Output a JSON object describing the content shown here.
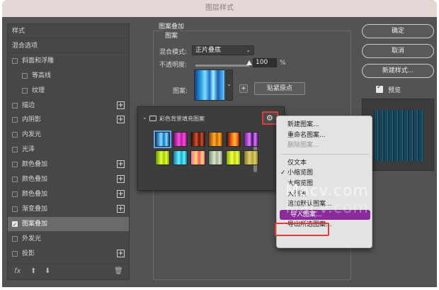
{
  "window": {
    "title": "图层样式"
  },
  "left_panel": {
    "items": [
      {
        "label": "样式",
        "checkbox": false,
        "checked": false,
        "indent": 0,
        "plus": false,
        "selected": false
      },
      {
        "label": "混合选项",
        "checkbox": false,
        "checked": false,
        "indent": 0,
        "plus": false,
        "selected": false
      },
      {
        "label": "斜面和浮雕",
        "checkbox": true,
        "checked": false,
        "indent": 0,
        "plus": false,
        "selected": false
      },
      {
        "label": "等高线",
        "checkbox": true,
        "checked": false,
        "indent": 1,
        "plus": false,
        "selected": false
      },
      {
        "label": "纹理",
        "checkbox": true,
        "checked": false,
        "indent": 1,
        "plus": false,
        "selected": false
      },
      {
        "label": "描边",
        "checkbox": true,
        "checked": false,
        "indent": 0,
        "plus": true,
        "selected": false
      },
      {
        "label": "内阴影",
        "checkbox": true,
        "checked": false,
        "indent": 0,
        "plus": true,
        "selected": false
      },
      {
        "label": "内发光",
        "checkbox": true,
        "checked": false,
        "indent": 0,
        "plus": false,
        "selected": false
      },
      {
        "label": "光泽",
        "checkbox": true,
        "checked": false,
        "indent": 0,
        "plus": false,
        "selected": false
      },
      {
        "label": "颜色叠加",
        "checkbox": true,
        "checked": false,
        "indent": 0,
        "plus": true,
        "selected": false
      },
      {
        "label": "颜色叠加",
        "checkbox": true,
        "checked": false,
        "indent": 0,
        "plus": true,
        "selected": false
      },
      {
        "label": "颜色叠加",
        "checkbox": true,
        "checked": false,
        "indent": 0,
        "plus": true,
        "selected": false
      },
      {
        "label": "渐变叠加",
        "checkbox": true,
        "checked": false,
        "indent": 0,
        "plus": true,
        "selected": false
      },
      {
        "label": "图案叠加",
        "checkbox": true,
        "checked": true,
        "indent": 0,
        "plus": false,
        "selected": true
      },
      {
        "label": "外发光",
        "checkbox": true,
        "checked": false,
        "indent": 0,
        "plus": false,
        "selected": false
      },
      {
        "label": "投影",
        "checkbox": true,
        "checked": false,
        "indent": 0,
        "plus": true,
        "selected": false
      }
    ],
    "footer": {
      "fx_label": "fx",
      "up_icon": "arrow-up-icon",
      "down_icon": "arrow-down-icon",
      "trash_icon": "trash-icon"
    }
  },
  "pattern_overlay": {
    "section_title": "图案叠加",
    "group_title": "图案",
    "blend_mode_label": "混合模式:",
    "blend_mode_value": "正片叠底",
    "opacity_label": "不透明度:",
    "opacity_value": "100",
    "opacity_unit": "%",
    "opacity_fraction": 1.0,
    "pattern_label": "图案:",
    "snap_origin_button": "贴紧原点"
  },
  "pattern_picker": {
    "group_name": "彩色背景填充图案",
    "gear_icon": "gear-icon",
    "tiles": [
      {
        "name": "pattern-tile-blue-streak",
        "colors": [
          "#0e3f8a",
          "#7fe0ff",
          "#1b70c9"
        ],
        "selected": true
      },
      {
        "name": "pattern-tile-magenta",
        "colors": [
          "#6a0d7a",
          "#ff4fd8",
          "#b31fa8"
        ],
        "selected": false
      },
      {
        "name": "pattern-tile-dark-red",
        "colors": [
          "#2a0a06",
          "#d6532a",
          "#581409"
        ],
        "selected": false
      },
      {
        "name": "pattern-tile-orange",
        "colors": [
          "#8a3d00",
          "#ffb02a",
          "#c86400"
        ],
        "selected": false
      },
      {
        "name": "pattern-tile-fire",
        "colors": [
          "#360903",
          "#ff6a1a",
          "#f0c040"
        ],
        "selected": false
      },
      {
        "name": "pattern-tile-purple",
        "colors": [
          "#6c1a8e",
          "#e07aff",
          "#3a0d60"
        ],
        "selected": false
      },
      {
        "name": "pattern-tile-lime",
        "colors": [
          "#6a8e00",
          "#e2ff3a",
          "#a8c800"
        ],
        "selected": false
      },
      {
        "name": "pattern-tile-cyan",
        "colors": [
          "#0a7ca8",
          "#6af0ff",
          "#1aa8d6"
        ],
        "selected": false
      },
      {
        "name": "pattern-tile-pink",
        "colors": [
          "#ff6fb8",
          "#ffe04a",
          "#ff3f8f"
        ],
        "selected": false
      },
      {
        "name": "pattern-tile-sage",
        "colors": [
          "#6a8a6a",
          "#e4e4d0",
          "#a0b08a"
        ],
        "selected": false
      },
      {
        "name": "pattern-tile-yellow-green",
        "colors": [
          "#8aa800",
          "#f0ff50",
          "#b8d600"
        ],
        "selected": false
      },
      {
        "name": "pattern-tile-olive",
        "colors": [
          "#8a7a20",
          "#e0d070",
          "#b0a040"
        ],
        "selected": false
      }
    ]
  },
  "context_menu": {
    "items": [
      {
        "label": "新建图案...",
        "disabled": false,
        "checked": false
      },
      {
        "label": "重命名图案...",
        "disabled": false,
        "checked": false
      },
      {
        "label": "删除图案...",
        "disabled": true,
        "checked": false
      },
      {
        "separator": true
      },
      {
        "label": "仅文本",
        "disabled": false,
        "checked": false
      },
      {
        "label": "小缩览图",
        "disabled": false,
        "checked": true
      },
      {
        "label": "大缩览图",
        "disabled": false,
        "checked": false
      },
      {
        "label": "大列表",
        "disabled": false,
        "checked": false
      },
      {
        "label": "追加默认图案...",
        "disabled": false,
        "checked": false
      },
      {
        "label": "导入图案...",
        "disabled": false,
        "checked": false,
        "highlighted": true
      },
      {
        "label": "导出所选图案...",
        "disabled": false,
        "checked": false
      }
    ]
  },
  "right_panel": {
    "ok_button": "确定",
    "cancel_button": "取消",
    "new_style_button": "新建样式...",
    "preview_label": "预览",
    "preview_checked": true
  },
  "watermarks": [
    "Macv.com",
    "Macv.com"
  ],
  "colors": {
    "accent_highlight": "#8a2a9b",
    "callout_red": "#e03c3c"
  }
}
